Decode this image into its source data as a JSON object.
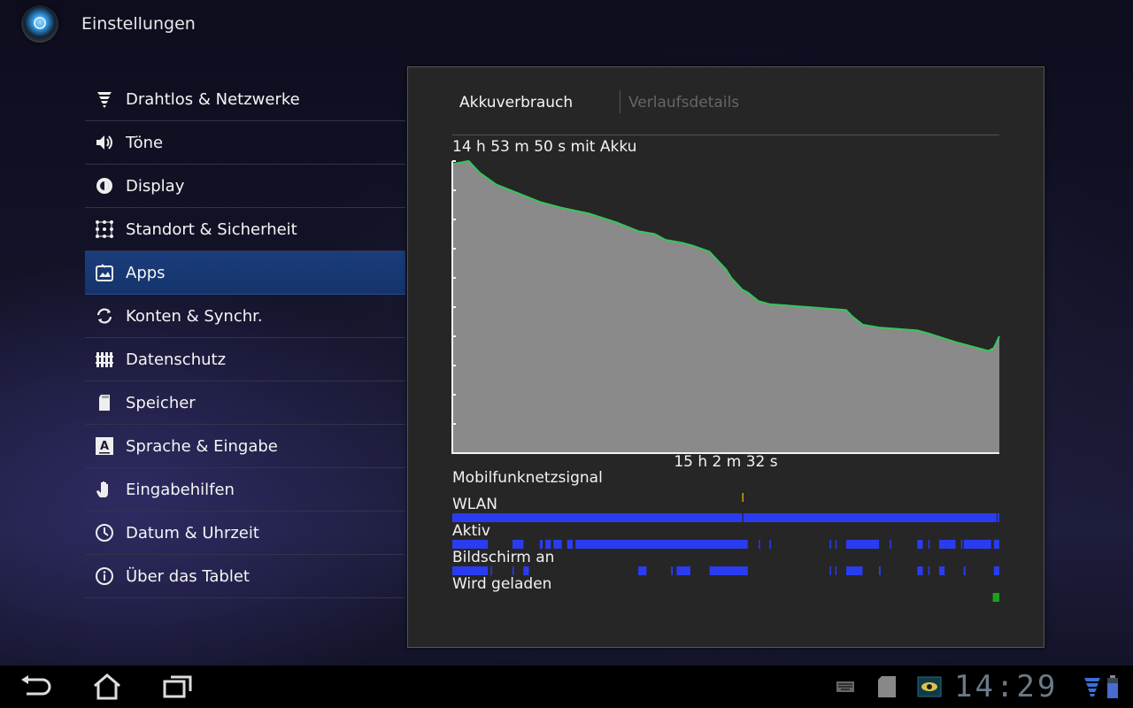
{
  "app": {
    "title": "Einstellungen",
    "icon": "settings-app-icon"
  },
  "menu": {
    "items": [
      {
        "label": "Drahtlos & Netzwerke",
        "icon": "wireless-icon",
        "selected": false
      },
      {
        "label": "Töne",
        "icon": "speaker-icon",
        "selected": false
      },
      {
        "label": "Display",
        "icon": "brightness-icon",
        "selected": false
      },
      {
        "label": "Standort & Sicherheit",
        "icon": "grid-dots-icon",
        "selected": false
      },
      {
        "label": "Apps",
        "icon": "apps-icon",
        "selected": true
      },
      {
        "label": "Konten & Synchr.",
        "icon": "sync-icon",
        "selected": false
      },
      {
        "label": "Datenschutz",
        "icon": "fence-icon",
        "selected": false
      },
      {
        "label": "Speicher",
        "icon": "sd-card-icon",
        "selected": false
      },
      {
        "label": "Sprache & Eingabe",
        "icon": "language-icon",
        "selected": false
      },
      {
        "label": "Eingabehilfen",
        "icon": "hand-icon",
        "selected": false
      },
      {
        "label": "Datum & Uhrzeit",
        "icon": "clock-icon",
        "selected": false
      },
      {
        "label": "Über das Tablet",
        "icon": "info-icon",
        "selected": false
      }
    ]
  },
  "pane": {
    "tabs": [
      {
        "label": "Akkuverbrauch",
        "active": true
      },
      {
        "label": "Verlaufsdetails",
        "active": false
      }
    ],
    "battery_duration": "14 h 53 m 50 s mit Akku",
    "total_time": "15 h 2 m 32 s"
  },
  "chart_data": {
    "type": "area",
    "x_unit": "fraction of timeline",
    "y_unit": "battery level (%)",
    "ylim": [
      0,
      100
    ],
    "points": [
      [
        0.0,
        99
      ],
      [
        0.03,
        100
      ],
      [
        0.05,
        96
      ],
      [
        0.08,
        92
      ],
      [
        0.12,
        89
      ],
      [
        0.16,
        86
      ],
      [
        0.2,
        84
      ],
      [
        0.25,
        82
      ],
      [
        0.3,
        79
      ],
      [
        0.34,
        76
      ],
      [
        0.37,
        75
      ],
      [
        0.39,
        73
      ],
      [
        0.42,
        72
      ],
      [
        0.44,
        71
      ],
      [
        0.47,
        69
      ],
      [
        0.48,
        67
      ],
      [
        0.49,
        65
      ],
      [
        0.5,
        63
      ],
      [
        0.51,
        60
      ],
      [
        0.53,
        56
      ],
      [
        0.54,
        55
      ],
      [
        0.56,
        52
      ],
      [
        0.58,
        51
      ],
      [
        0.65,
        50
      ],
      [
        0.72,
        49
      ],
      [
        0.73,
        47
      ],
      [
        0.75,
        44
      ],
      [
        0.78,
        43
      ],
      [
        0.85,
        42
      ],
      [
        0.87,
        41
      ],
      [
        0.92,
        38
      ],
      [
        0.98,
        35
      ],
      [
        0.99,
        36
      ],
      [
        1.0,
        40
      ]
    ],
    "fill_color": "#8a8a8a",
    "line_color": "#34c75a"
  },
  "signals": [
    {
      "label": "Mobilfunknetzsignal",
      "segments": [
        [
          0.53,
          0.532
        ]
      ],
      "color": "#c8a400"
    },
    {
      "label": "WLAN",
      "segments": [
        [
          0.0,
          0.53
        ],
        [
          0.532,
          0.995
        ],
        [
          0.997,
          1.0
        ]
      ],
      "color": "#2a3cf0"
    },
    {
      "label": "Aktiv",
      "segments": [
        [
          0.0,
          0.065
        ],
        [
          0.11,
          0.13
        ],
        [
          0.16,
          0.165
        ],
        [
          0.17,
          0.18
        ],
        [
          0.185,
          0.2
        ],
        [
          0.21,
          0.22
        ],
        [
          0.225,
          0.54
        ],
        [
          0.56,
          0.562
        ],
        [
          0.58,
          0.582
        ],
        [
          0.69,
          0.692
        ],
        [
          0.7,
          0.702
        ],
        [
          0.72,
          0.78
        ],
        [
          0.8,
          0.802
        ],
        [
          0.85,
          0.86
        ],
        [
          0.87,
          0.872
        ],
        [
          0.89,
          0.9
        ],
        [
          0.9,
          0.92
        ],
        [
          0.93,
          0.932
        ],
        [
          0.935,
          0.985
        ],
        [
          0.99,
          1.0
        ]
      ],
      "color": "#2a3cf0"
    },
    {
      "label": "Bildschirm an",
      "segments": [
        [
          0.0,
          0.065
        ],
        [
          0.07,
          0.072
        ],
        [
          0.11,
          0.112
        ],
        [
          0.13,
          0.14
        ],
        [
          0.34,
          0.355
        ],
        [
          0.4,
          0.403
        ],
        [
          0.41,
          0.435
        ],
        [
          0.47,
          0.54
        ],
        [
          0.69,
          0.692
        ],
        [
          0.7,
          0.702
        ],
        [
          0.72,
          0.75
        ],
        [
          0.78,
          0.783
        ],
        [
          0.85,
          0.86
        ],
        [
          0.87,
          0.872
        ],
        [
          0.89,
          0.9
        ],
        [
          0.935,
          0.938
        ],
        [
          0.99,
          1.0
        ]
      ],
      "color": "#2a3cf0"
    },
    {
      "label": "Wird geladen",
      "segments": [
        [
          0.988,
          1.0
        ]
      ],
      "color": "#1aa31a"
    }
  ],
  "navbar": {
    "buttons": [
      "back-icon",
      "home-icon",
      "recent-apps-icon"
    ],
    "status_icons": [
      "keyboard-icon",
      "sd-card-status-icon",
      "eye-notification-icon"
    ],
    "clock": "14:29",
    "wifi": "wifi-signal-icon",
    "battery": "battery-icon"
  }
}
